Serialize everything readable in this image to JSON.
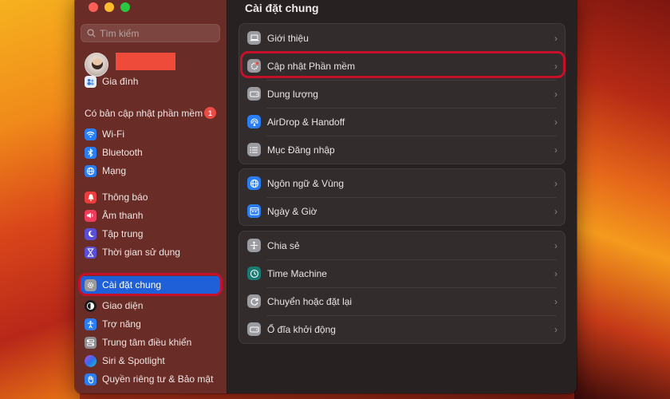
{
  "colors": {
    "accent_selected": "#1f5fd8",
    "highlight_outline": "#c6102a",
    "badge": "#ec4c46"
  },
  "sidebar": {
    "search_placeholder": "Tìm kiếm",
    "family_label": "Gia đình",
    "update_label": "Có bản cập nhật phần mềm",
    "update_badge": "1",
    "items": [
      {
        "label": "Wi-Fi",
        "icon": "wifi-icon"
      },
      {
        "label": "Bluetooth",
        "icon": "bluetooth-icon"
      },
      {
        "label": "Mạng",
        "icon": "network-globe-icon"
      },
      {
        "label": "Thông báo",
        "icon": "bell-icon"
      },
      {
        "label": "Âm thanh",
        "icon": "speaker-icon"
      },
      {
        "label": "Tập trung",
        "icon": "moon-icon"
      },
      {
        "label": "Thời gian sử dụng",
        "icon": "hourglass-icon"
      },
      {
        "label": "Cài đặt chung",
        "icon": "gear-icon",
        "selected": true
      },
      {
        "label": "Giao diện",
        "icon": "appearance-icon"
      },
      {
        "label": "Trợ năng",
        "icon": "accessibility-icon"
      },
      {
        "label": "Trung tâm điều khiển",
        "icon": "control-center-icon"
      },
      {
        "label": "Siri & Spotlight",
        "icon": "siri-icon"
      },
      {
        "label": "Quyền riêng tư & Bảo mật",
        "icon": "hand-icon"
      }
    ]
  },
  "main": {
    "title": "Cài đặt chung",
    "groups": [
      [
        {
          "label": "Giới thiệu",
          "icon": "laptop-icon"
        },
        {
          "label": "Cập nhật Phần mềm",
          "icon": "gear-badge-icon",
          "highlighted": true
        },
        {
          "label": "Dung lượng",
          "icon": "drive-icon"
        },
        {
          "label": "AirDrop & Handoff",
          "icon": "airdrop-icon"
        },
        {
          "label": "Mục Đăng nhập",
          "icon": "list-icon"
        }
      ],
      [
        {
          "label": "Ngôn ngữ & Vùng",
          "icon": "globe-icon"
        },
        {
          "label": "Ngày & Giờ",
          "icon": "calendar-icon"
        }
      ],
      [
        {
          "label": "Chia sẻ",
          "icon": "share-icon"
        },
        {
          "label": "Time Machine",
          "icon": "clock-icon"
        },
        {
          "label": "Chuyển hoặc đặt lại",
          "icon": "reset-icon"
        },
        {
          "label": "Ổ đĩa khởi động",
          "icon": "startup-disk-icon"
        }
      ]
    ]
  }
}
